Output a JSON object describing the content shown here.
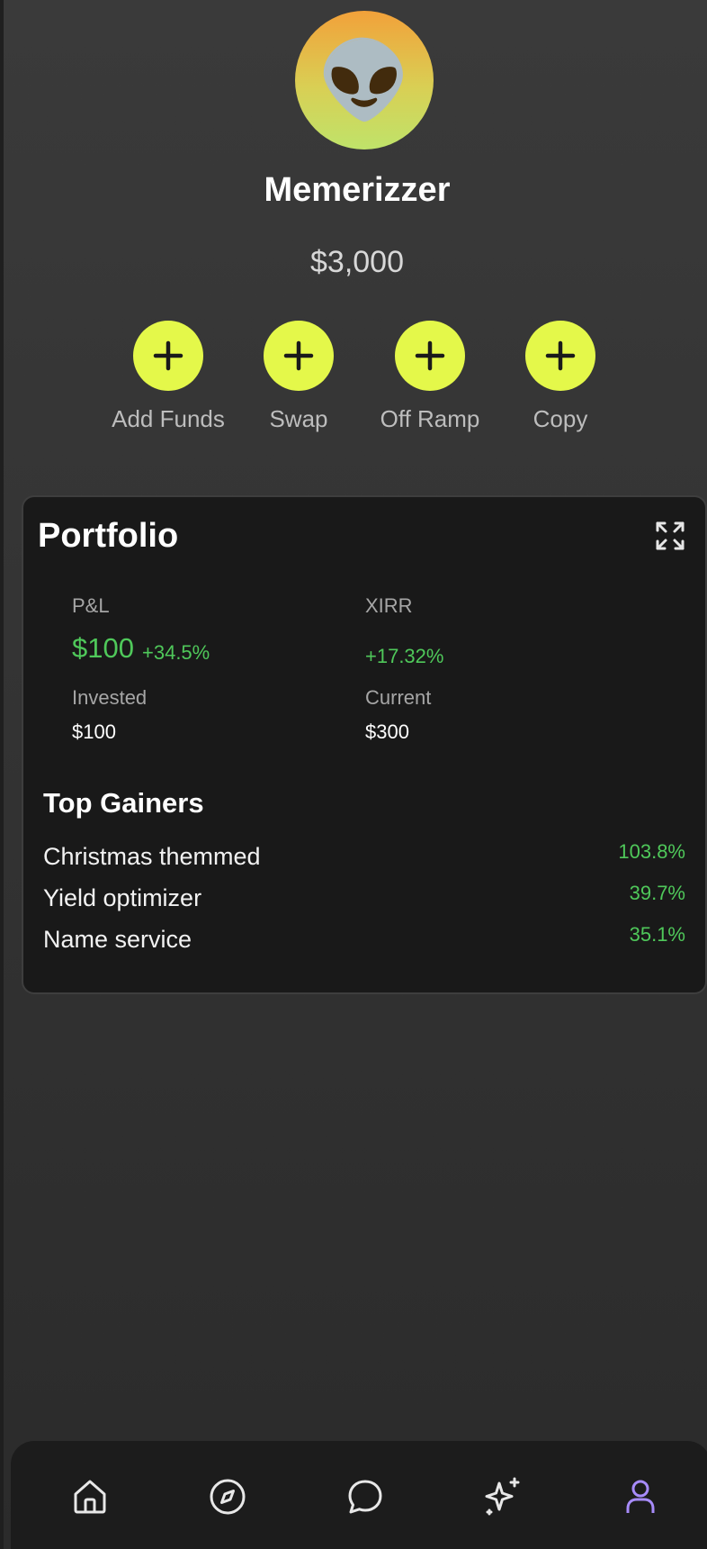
{
  "profile": {
    "avatar_emoji": "👽",
    "username": "Memerizzer",
    "balance": "$3,000"
  },
  "actions": [
    {
      "label": "Add Funds",
      "icon": "plus-icon"
    },
    {
      "label": "Swap",
      "icon": "plus-icon"
    },
    {
      "label": "Off Ramp",
      "icon": "plus-icon"
    },
    {
      "label": "Copy",
      "icon": "plus-icon"
    }
  ],
  "portfolio": {
    "title": "Portfolio",
    "expand_icon": "expand-icon",
    "pnl_label": "P&L",
    "pnl_value": "$100",
    "pnl_percent": "+34.5%",
    "xirr_label": "XIRR",
    "xirr_value": "+17.32%",
    "invested_label": "Invested",
    "invested_value": "$100",
    "current_label": "Current",
    "current_value": "$300",
    "top_gainers_title": "Top Gainers",
    "top_gainers": [
      {
        "name": "Christmas themmed",
        "change": "103.8%"
      },
      {
        "name": "Yield optimizer",
        "change": "39.7%"
      },
      {
        "name": "Name service",
        "change": "35.1%"
      }
    ]
  },
  "bottom_nav": [
    {
      "icon": "home-icon",
      "active": false
    },
    {
      "icon": "compass-icon",
      "active": false
    },
    {
      "icon": "chat-icon",
      "active": false
    },
    {
      "icon": "sparkles-icon",
      "active": false
    },
    {
      "icon": "profile-icon",
      "active": true
    }
  ],
  "colors": {
    "accent": "#e4f84a",
    "positive": "#4fc85a",
    "active_nav": "#a78bfa",
    "card_background": "#191919",
    "page_background": "#333333"
  }
}
